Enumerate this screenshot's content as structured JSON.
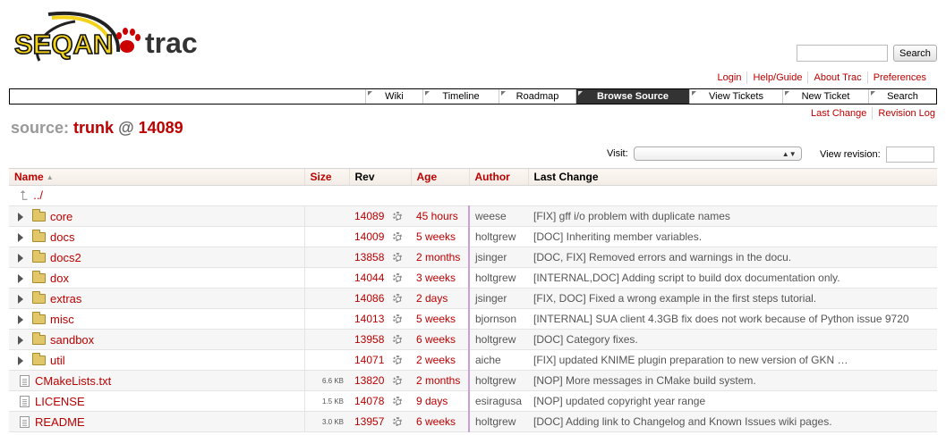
{
  "brand": {
    "logo_text": "SEQAN",
    "trac_text": "trac"
  },
  "search": {
    "placeholder": "",
    "button_label": "Search"
  },
  "metanav": [
    "Login",
    "Help/Guide",
    "About Trac",
    "Preferences"
  ],
  "mainnav": [
    {
      "label": "Wiki",
      "active": false
    },
    {
      "label": "Timeline",
      "active": false
    },
    {
      "label": "Roadmap",
      "active": false
    },
    {
      "label": "Browse Source",
      "active": true
    },
    {
      "label": "View Tickets",
      "active": false
    },
    {
      "label": "New Ticket",
      "active": false
    },
    {
      "label": "Search",
      "active": false
    }
  ],
  "ctxtnav": [
    "Last Change",
    "Revision Log"
  ],
  "title": {
    "prefix": "source:",
    "path": "trunk",
    "at": "@",
    "rev": "14089"
  },
  "visit": {
    "label": "Visit:",
    "value": ""
  },
  "view_revision": {
    "label": "View revision:",
    "value": ""
  },
  "columns": {
    "name": "Name",
    "size": "Size",
    "rev": "Rev",
    "age": "Age",
    "author": "Author",
    "change": "Last Change"
  },
  "parent_link": "../",
  "rows": [
    {
      "type": "dir",
      "name": "core",
      "size": "",
      "rev": "14089",
      "age": "45 hours",
      "author": "weese",
      "change": "[FIX] gff i/o problem with duplicate names"
    },
    {
      "type": "dir",
      "name": "docs",
      "size": "",
      "rev": "14009",
      "age": "5 weeks",
      "author": "holtgrew",
      "change": "[DOC] Inheriting member variables."
    },
    {
      "type": "dir",
      "name": "docs2",
      "size": "",
      "rev": "13858",
      "age": "2 months",
      "author": "jsinger",
      "change": "[DOC, FIX] Removed errors and warnings in the docu."
    },
    {
      "type": "dir",
      "name": "dox",
      "size": "",
      "rev": "14044",
      "age": "3 weeks",
      "author": "holtgrew",
      "change": "[INTERNAL,DOC] Adding script to build dox documentation only."
    },
    {
      "type": "dir",
      "name": "extras",
      "size": "",
      "rev": "14086",
      "age": "2 days",
      "author": "jsinger",
      "change": "[FIX, DOC] Fixed a wrong example in the first steps tutorial."
    },
    {
      "type": "dir",
      "name": "misc",
      "size": "",
      "rev": "14013",
      "age": "5 weeks",
      "author": "bjornson",
      "change": "[INTERNAL] SUA client 4.3GB fix does not work because of Python issue 9720"
    },
    {
      "type": "dir",
      "name": "sandbox",
      "size": "",
      "rev": "13958",
      "age": "6 weeks",
      "author": "holtgrew",
      "change": "[DOC] Category fixes."
    },
    {
      "type": "dir",
      "name": "util",
      "size": "",
      "rev": "14071",
      "age": "2 weeks",
      "author": "aiche",
      "change": "[FIX] updated KNIME plugin preparation to new version of GKN …"
    },
    {
      "type": "file",
      "name": "CMakeLists.txt",
      "size": "6.6 KB",
      "rev": "13820",
      "age": "2 months",
      "author": "holtgrew",
      "change": "[NOP] More messages in CMake build system."
    },
    {
      "type": "file",
      "name": "LICENSE",
      "size": "1.5 KB",
      "rev": "14078",
      "age": "9 days",
      "author": "esiragusa",
      "change": "[NOP] updated copyright year range"
    },
    {
      "type": "file",
      "name": "README",
      "size": "3.0 KB",
      "rev": "13957",
      "age": "6 weeks",
      "author": "holtgrew",
      "change": "[DOC] Adding link to Changelog and Known Issues wiki pages."
    }
  ]
}
